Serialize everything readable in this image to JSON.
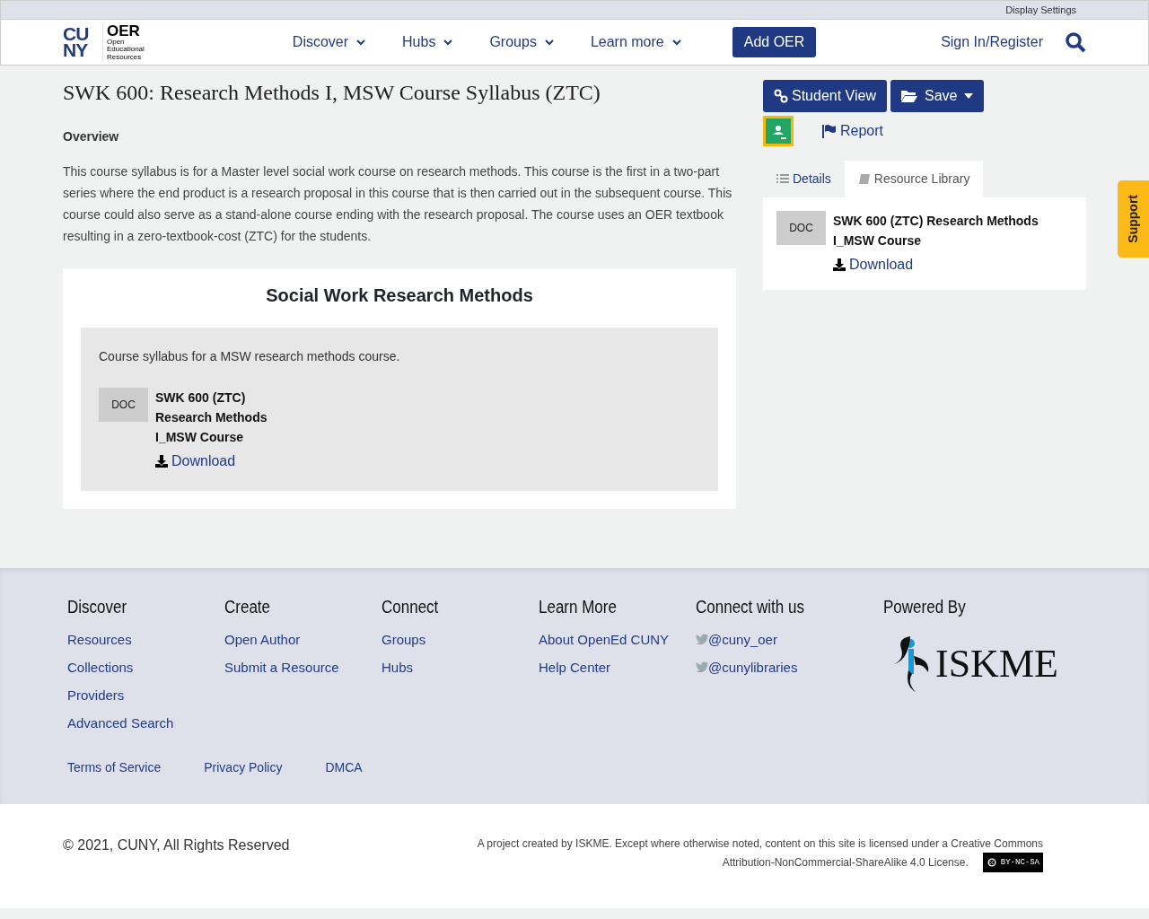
{
  "top_bar": {
    "link": "Display Settings"
  },
  "header": {
    "logo": {
      "mark": "CUNY",
      "name": "OER",
      "tagline": "Open Educational Resources"
    },
    "nav": [
      {
        "label": "Discover",
        "dropdown": true
      },
      {
        "label": "Hubs",
        "dropdown": true
      },
      {
        "label": "Groups",
        "dropdown": true
      },
      {
        "label": "Learn more",
        "dropdown": true
      }
    ],
    "add_button": "Add OER",
    "sign_in": "Sign In/Register"
  },
  "page": {
    "title": "SWK 600: Research Methods I, MSW Course Syllabus (ZTC)",
    "overview_heading": "Overview",
    "overview": "This course syllabus is for a Master level social work course on research methods. This course is the first in a two-part series where the end product is a research proposal in this course that is then carried out in the subsequent course. This course could also serve as a stand-alone course ending with the research proposal. The course uses an OER textbook resulting in a zero-textbook-cost (ZTC) for the students.",
    "section": {
      "title": "Social Work Research Methods",
      "description": "Course syllabus for a MSW research methods course.",
      "file": {
        "type": "DOC",
        "name": "SWK 600 (ZTC) Research Methods I_MSW Course",
        "download": "Download"
      }
    }
  },
  "sidebar": {
    "student_view": "Student View",
    "save": "Save",
    "report": "Report",
    "tabs": [
      {
        "label": "Details",
        "selected": false
      },
      {
        "label": "Resource Library",
        "selected": true
      }
    ],
    "file": {
      "type": "DOC",
      "name": "SWK 600 (ZTC) Research Methods I_MSW Course",
      "download": "Download"
    }
  },
  "support_tab": "Support",
  "footer": {
    "columns": [
      {
        "heading": "Discover",
        "links": [
          "Resources",
          "Collections",
          "Providers",
          "Advanced Search"
        ]
      },
      {
        "heading": "Create",
        "links": [
          "Open Author",
          "Submit a Resource"
        ]
      },
      {
        "heading": "Connect",
        "links": [
          "Groups",
          "Hubs"
        ]
      },
      {
        "heading": "Learn More",
        "links": [
          "About OpenEd CUNY",
          "Help Center"
        ]
      },
      {
        "heading": "Connect with us",
        "links": [
          "@cuny_oer",
          "@cunylibraries"
        ],
        "kind": "social"
      }
    ],
    "powered_by": "Powered By",
    "partner_logo": "ISKME",
    "legal": [
      "Terms of Service",
      "Privacy Policy",
      "DMCA"
    ]
  },
  "bottom": {
    "copyright": "© 2021, CUNY, All Rights Reserved",
    "license_line1": "A project created by ISKME. Except where otherwise noted, content on this site is licensed under a Creative Commons",
    "license_line2": "Attribution-NonCommercial-ShareAlike 4.0 License.",
    "badge": "BY-NC-SA"
  }
}
